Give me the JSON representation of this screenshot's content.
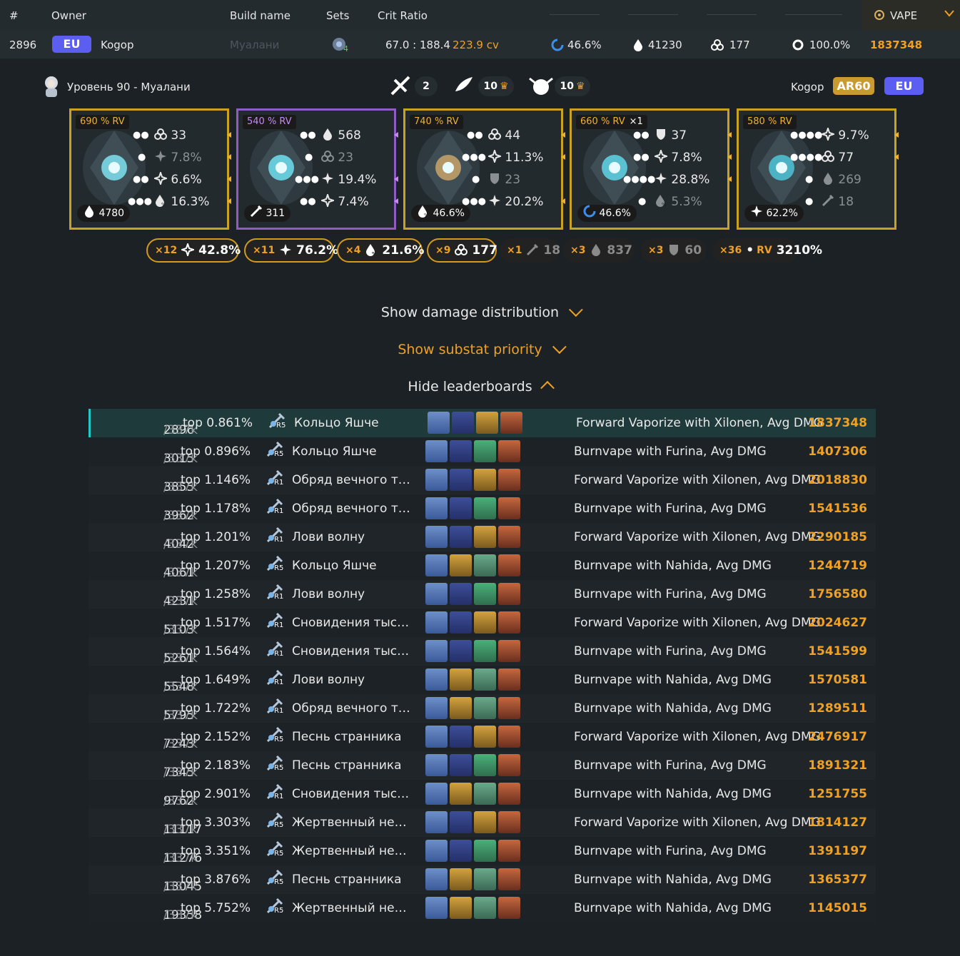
{
  "header": {
    "col_rank": "#",
    "col_owner": "Owner",
    "col_build": "Build name",
    "col_sets": "Sets",
    "col_crit": "Crit Ratio",
    "category": "VAPE"
  },
  "summary": {
    "rank": "2896",
    "region": "EU",
    "owner": "Kogop",
    "build_name": "Муалани",
    "set_count": "4",
    "crit_ratio": "67.0 : 188.4",
    "crit_value": "223.9 cv",
    "hydro_dmg": "46.6%",
    "hp": "41230",
    "em": "177",
    "er": "100.0%",
    "damage": "1837348"
  },
  "profile": {
    "level_name": "Уровень 90 - Муалани",
    "talent_1": "2",
    "talent_2": "10",
    "talent_3": "10",
    "owner": "Kogop",
    "ar": "AR60",
    "region": "EU"
  },
  "artifacts": [
    {
      "rv": "690 % RV",
      "main": "4780",
      "subs": [
        {
          "stat": "em",
          "value": "33",
          "dim": false
        },
        {
          "stat": "crit-dmg",
          "value": "7.8%",
          "dim": true
        },
        {
          "stat": "crit-rate",
          "value": "6.6%",
          "dim": false
        },
        {
          "stat": "hp-pct",
          "value": "16.3%",
          "dim": false
        }
      ]
    },
    {
      "rv": "540 % RV",
      "main": "311",
      "subs": [
        {
          "stat": "hp",
          "value": "568",
          "dim": false
        },
        {
          "stat": "em",
          "value": "23",
          "dim": true
        },
        {
          "stat": "crit-dmg",
          "value": "19.4%",
          "dim": false
        },
        {
          "stat": "crit-rate",
          "value": "7.4%",
          "dim": false
        }
      ]
    },
    {
      "rv": "740 % RV",
      "main": "46.6%",
      "subs": [
        {
          "stat": "em",
          "value": "44",
          "dim": false
        },
        {
          "stat": "crit-rate",
          "value": "11.3%",
          "dim": false
        },
        {
          "stat": "def",
          "value": "23",
          "dim": true
        },
        {
          "stat": "crit-dmg",
          "value": "20.2%",
          "dim": false
        }
      ]
    },
    {
      "rv": "660 % RV",
      "reroll": "×1",
      "main": "46.6%",
      "subs": [
        {
          "stat": "def",
          "value": "37",
          "dim": false
        },
        {
          "stat": "crit-rate",
          "value": "7.8%",
          "dim": false
        },
        {
          "stat": "crit-dmg",
          "value": "28.8%",
          "dim": false
        },
        {
          "stat": "hp-pct",
          "value": "5.3%",
          "dim": true
        }
      ]
    },
    {
      "rv": "580 % RV",
      "main": "62.2%",
      "subs": [
        {
          "stat": "crit-rate",
          "value": "9.7%",
          "dim": false
        },
        {
          "stat": "em",
          "value": "77",
          "dim": false
        },
        {
          "stat": "hp",
          "value": "269",
          "dim": true
        },
        {
          "stat": "atk",
          "value": "18",
          "dim": true
        }
      ]
    }
  ],
  "totals": [
    {
      "count": "×12",
      "icon": "crit-rate-icon",
      "value": "42.8%",
      "gold": true
    },
    {
      "count": "×11",
      "icon": "crit-dmg-icon",
      "value": "76.2%",
      "gold": true
    },
    {
      "count": "×4",
      "icon": "hp-pct-icon",
      "value": "21.6%",
      "gold": true
    },
    {
      "count": "×9",
      "icon": "em-icon",
      "value": "177",
      "gold": true
    },
    {
      "count": "×1",
      "icon": "atk-icon",
      "value": "18",
      "gold": false
    },
    {
      "count": "×3",
      "icon": "hp-icon",
      "value": "837",
      "gold": false
    },
    {
      "count": "×3",
      "icon": "def-icon",
      "value": "60",
      "gold": false
    },
    {
      "count": "×36",
      "icon": "rv-label",
      "value": "3210%",
      "gold": false,
      "rv": "RV"
    }
  ],
  "toggles": {
    "damage": "Show damage distribution",
    "substat": "Show substat priority",
    "leaderboards": "Hide leaderboards"
  },
  "colors": {
    "accent": "#f0a023",
    "highlight": "#23c7c7",
    "eu": "#5b5ef0"
  },
  "leaderboard": [
    {
      "rank": "2896",
      "total": "/337k",
      "top": "top 0.861%",
      "refine": "R5",
      "weapon": "Кольцо Яшче",
      "team": [
        "c1",
        "c2",
        "c3",
        "c4"
      ],
      "calc": "Forward Vaporize with Xilonen, Avg DMG",
      "dmg": "1837348"
    },
    {
      "rank": "3015",
      "total": "/337k",
      "top": "top 0.896%",
      "refine": "R5",
      "weapon": "Кольцо Яшче",
      "team": [
        "c1",
        "c2",
        "c5",
        "c4"
      ],
      "calc": "Burnvape with Furina, Avg DMG",
      "dmg": "1407306"
    },
    {
      "rank": "3855",
      "total": "/337k",
      "top": "top 1.146%",
      "refine": "R1",
      "weapon": "Обряд вечного те...",
      "team": [
        "c1",
        "c2",
        "c3",
        "c4"
      ],
      "calc": "Forward Vaporize with Xilonen, Avg DMG",
      "dmg": "2018830"
    },
    {
      "rank": "3962",
      "total": "/337k",
      "top": "top 1.178%",
      "refine": "R1",
      "weapon": "Обряд вечного те...",
      "team": [
        "c1",
        "c2",
        "c5",
        "c4"
      ],
      "calc": "Burnvape with Furina, Avg DMG",
      "dmg": "1541536"
    },
    {
      "rank": "4042",
      "total": "/337k",
      "top": "top 1.201%",
      "refine": "R1",
      "weapon": "Лови волну",
      "team": [
        "c1",
        "c2",
        "c3",
        "c4"
      ],
      "calc": "Forward Vaporize with Xilonen, Avg DMG",
      "dmg": "2290185"
    },
    {
      "rank": "4061",
      "total": "/337k",
      "top": "top 1.207%",
      "refine": "R5",
      "weapon": "Кольцо Яшче",
      "team": [
        "c1",
        "c3",
        "c6",
        "c4"
      ],
      "calc": "Burnvape with Nahida, Avg DMG",
      "dmg": "1244719"
    },
    {
      "rank": "4231",
      "total": "/337k",
      "top": "top 1.258%",
      "refine": "R1",
      "weapon": "Лови волну",
      "team": [
        "c1",
        "c2",
        "c5",
        "c4"
      ],
      "calc": "Burnvape with Furina, Avg DMG",
      "dmg": "1756580"
    },
    {
      "rank": "5103",
      "total": "/337k",
      "top": "top 1.517%",
      "refine": "R1",
      "weapon": "Сновидения тысяч...",
      "team": [
        "c1",
        "c2",
        "c3",
        "c4"
      ],
      "calc": "Forward Vaporize with Xilonen, Avg DMG",
      "dmg": "2024627"
    },
    {
      "rank": "5261",
      "total": "/337k",
      "top": "top 1.564%",
      "refine": "R1",
      "weapon": "Сновидения тысяч...",
      "team": [
        "c1",
        "c2",
        "c5",
        "c4"
      ],
      "calc": "Burnvape with Furina, Avg DMG",
      "dmg": "1541599"
    },
    {
      "rank": "5548",
      "total": "/337k",
      "top": "top 1.649%",
      "refine": "R1",
      "weapon": "Лови волну",
      "team": [
        "c1",
        "c3",
        "c6",
        "c4"
      ],
      "calc": "Burnvape with Nahida, Avg DMG",
      "dmg": "1570581"
    },
    {
      "rank": "5795",
      "total": "/337k",
      "top": "top 1.722%",
      "refine": "R1",
      "weapon": "Обряд вечного те...",
      "team": [
        "c1",
        "c3",
        "c6",
        "c4"
      ],
      "calc": "Burnvape with Nahida, Avg DMG",
      "dmg": "1289511"
    },
    {
      "rank": "7243",
      "total": "/337k",
      "top": "top 2.152%",
      "refine": "R5",
      "weapon": "Песнь странника",
      "team": [
        "c1",
        "c2",
        "c3",
        "c4"
      ],
      "calc": "Forward Vaporize with Xilonen, Avg DMG",
      "dmg": "2476917"
    },
    {
      "rank": "7345",
      "total": "/337k",
      "top": "top 2.183%",
      "refine": "R5",
      "weapon": "Песнь странника",
      "team": [
        "c1",
        "c2",
        "c5",
        "c4"
      ],
      "calc": "Burnvape with Furina, Avg DMG",
      "dmg": "1891321"
    },
    {
      "rank": "9762",
      "total": "/337k",
      "top": "top 2.901%",
      "refine": "R1",
      "weapon": "Сновидения тысяч...",
      "team": [
        "c1",
        "c3",
        "c6",
        "c4"
      ],
      "calc": "Burnvape with Nahida, Avg DMG",
      "dmg": "1251755"
    },
    {
      "rank": "11117",
      "total": "/337k",
      "top": "top 3.303%",
      "refine": "R5",
      "weapon": "Жертвенный нефр...",
      "team": [
        "c1",
        "c2",
        "c3",
        "c4"
      ],
      "calc": "Forward Vaporize with Xilonen, Avg DMG",
      "dmg": "1814127"
    },
    {
      "rank": "11276",
      "total": "/337k",
      "top": "top 3.351%",
      "refine": "R5",
      "weapon": "Жертвенный нефр...",
      "team": [
        "c1",
        "c2",
        "c5",
        "c4"
      ],
      "calc": "Burnvape with Furina, Avg DMG",
      "dmg": "1391197"
    },
    {
      "rank": "13045",
      "total": "/337k",
      "top": "top 3.876%",
      "refine": "R5",
      "weapon": "Песнь странника",
      "team": [
        "c1",
        "c3",
        "c6",
        "c4"
      ],
      "calc": "Burnvape with Nahida, Avg DMG",
      "dmg": "1365377"
    },
    {
      "rank": "19358",
      "total": "/337k",
      "top": "top 5.752%",
      "refine": "R5",
      "weapon": "Жертвенный нефр...",
      "team": [
        "c1",
        "c3",
        "c6",
        "c4"
      ],
      "calc": "Burnvape with Nahida, Avg DMG",
      "dmg": "1145015"
    }
  ]
}
